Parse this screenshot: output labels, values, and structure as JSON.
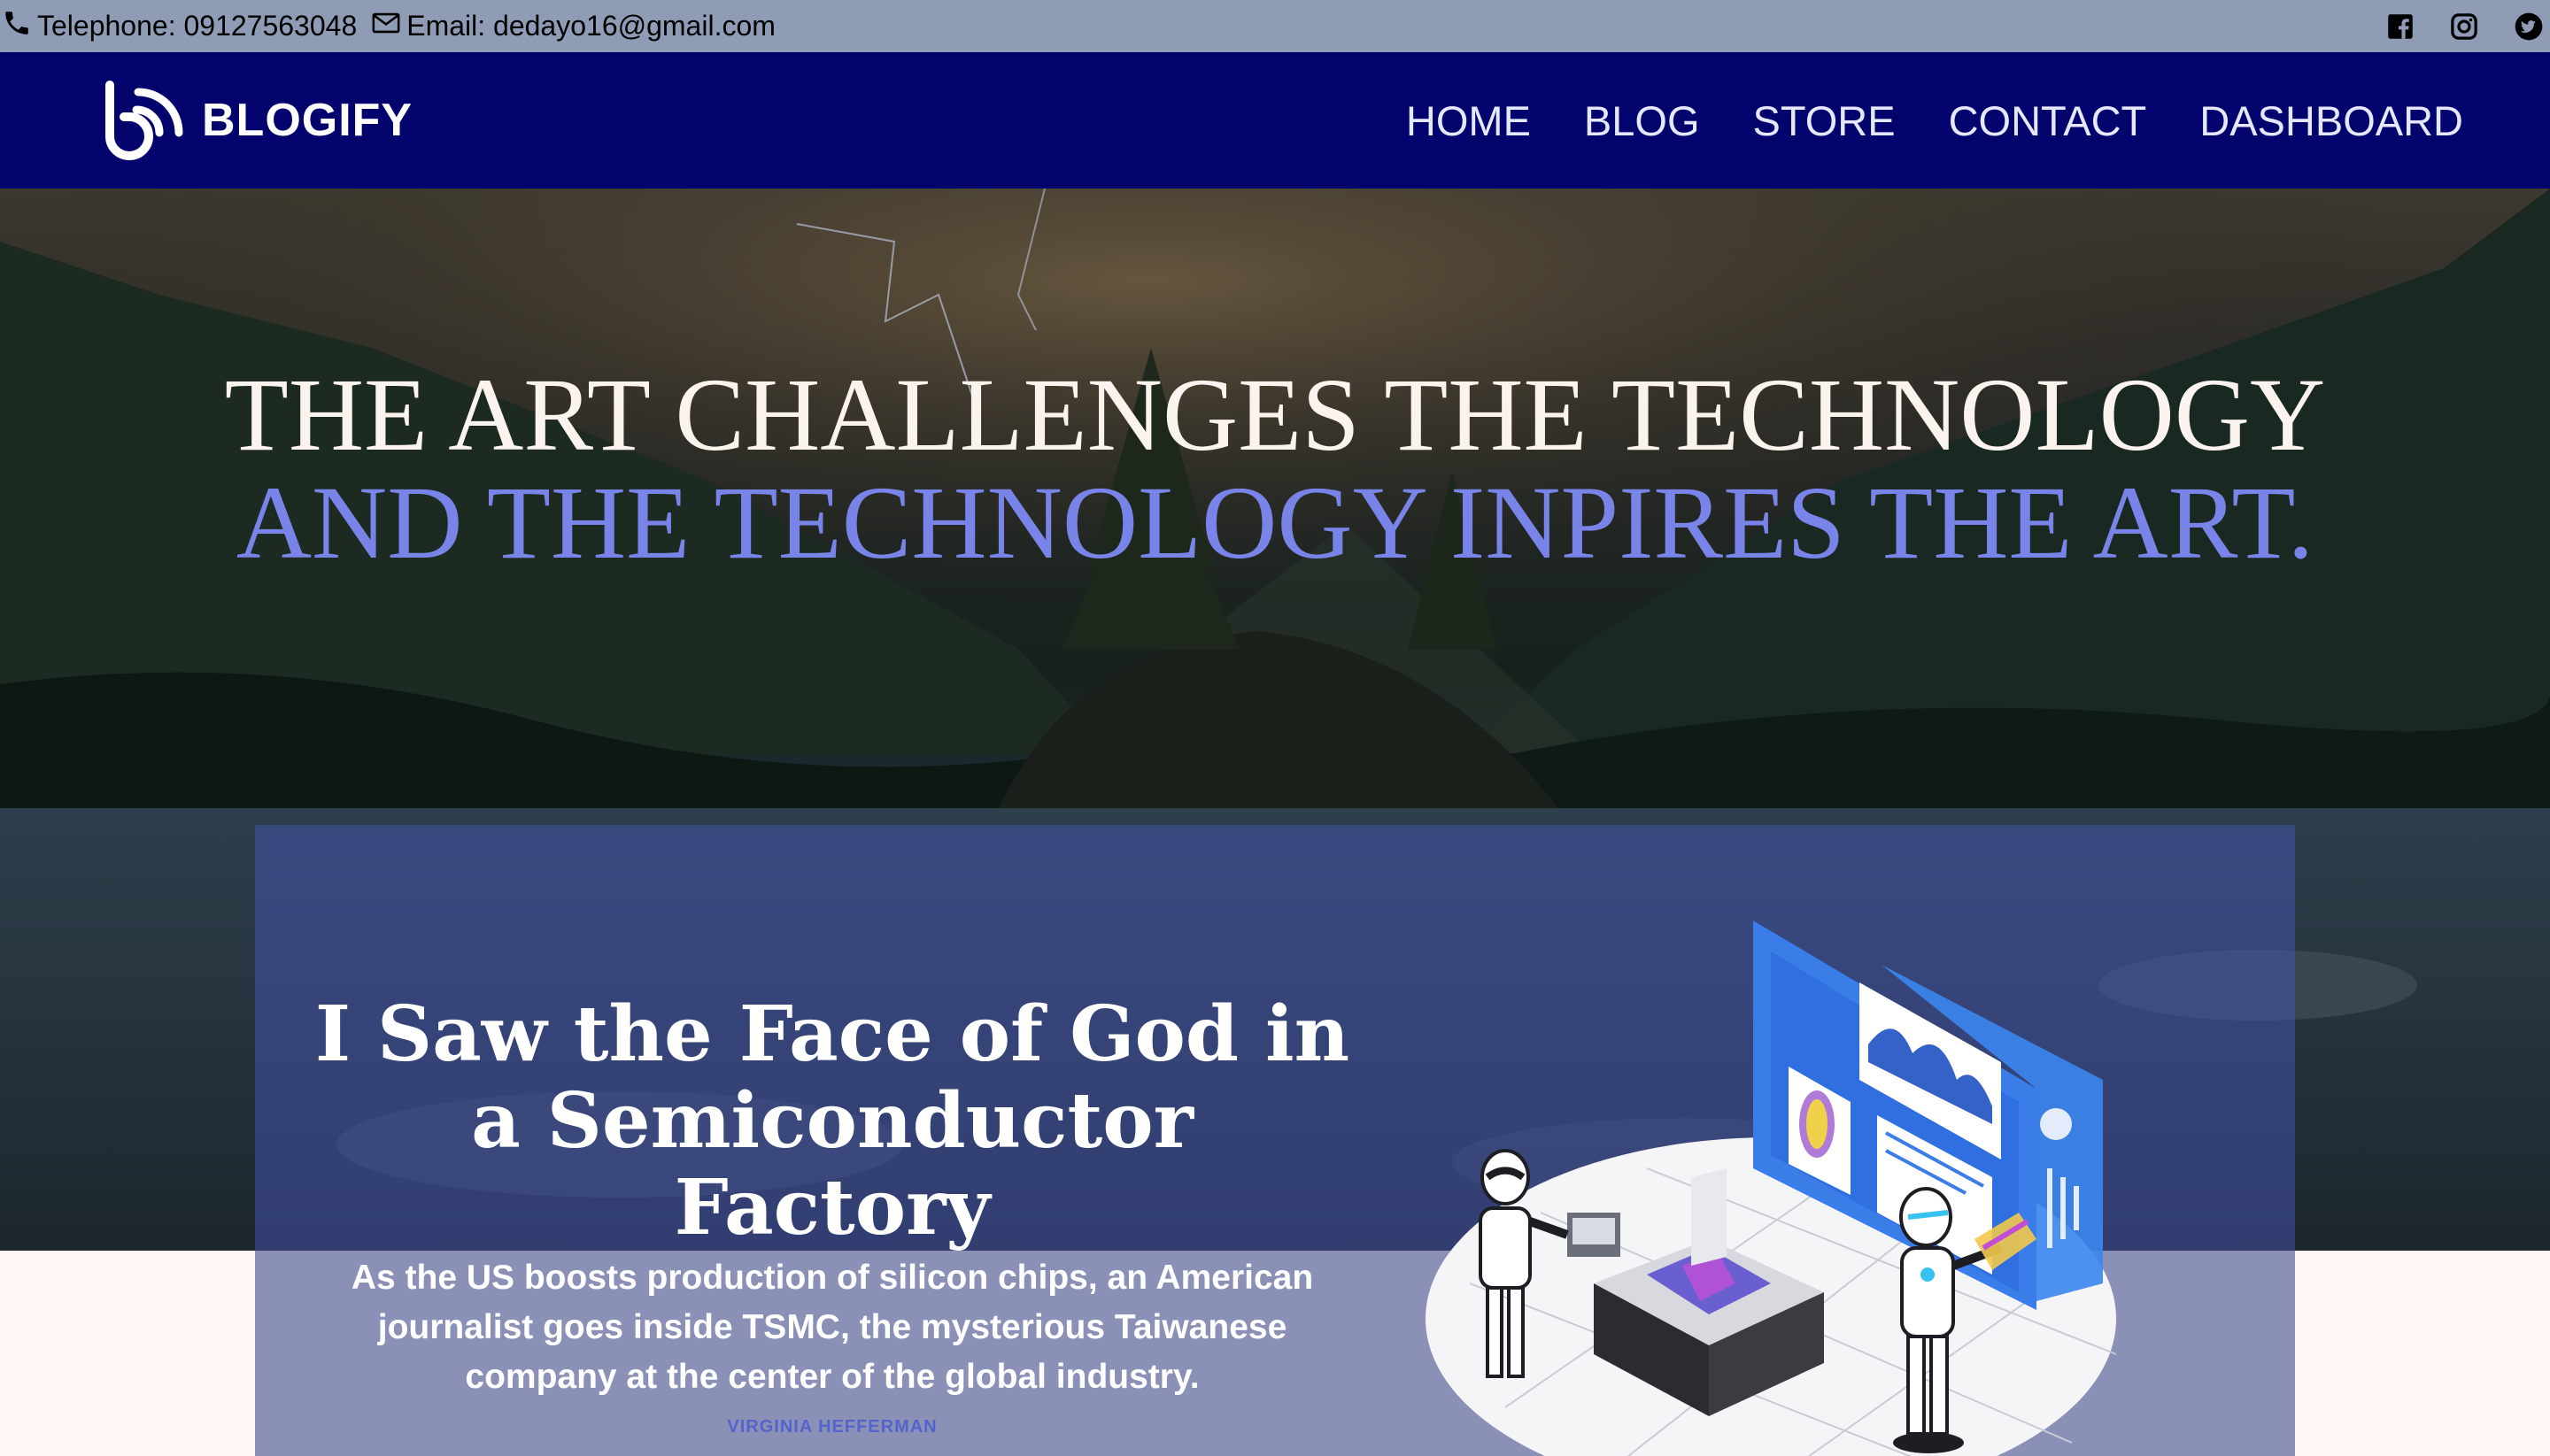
{
  "topbar": {
    "telephone": "Telephone: 09127563048",
    "email": "Email: dedayo16@gmail.com",
    "socials": [
      "facebook-icon",
      "instagram-icon",
      "twitter-icon"
    ]
  },
  "navbar": {
    "brand": "BLOGIFY",
    "links": [
      "HOME",
      "BLOG",
      "STORE",
      "CONTACT",
      "DASHBOARD"
    ]
  },
  "hero": {
    "line1": "THE ART CHALLENGES THE TECHNOLOGY",
    "line2": "AND THE TECHNOLOGY INPIRES THE ART."
  },
  "featured": {
    "title": "I Saw the Face of God in a Semiconductor Factory",
    "description": "As the US boosts production of silicon chips, an American journalist goes inside TSMC, the mysterious Taiwanese company at the center of the global industry.",
    "author": "VIRGINIA HEFFERMAN"
  },
  "colors": {
    "topbar": "#8f9cb6",
    "navbar": "#03036e",
    "accent": "#7884e8",
    "card": "#4452aa"
  }
}
